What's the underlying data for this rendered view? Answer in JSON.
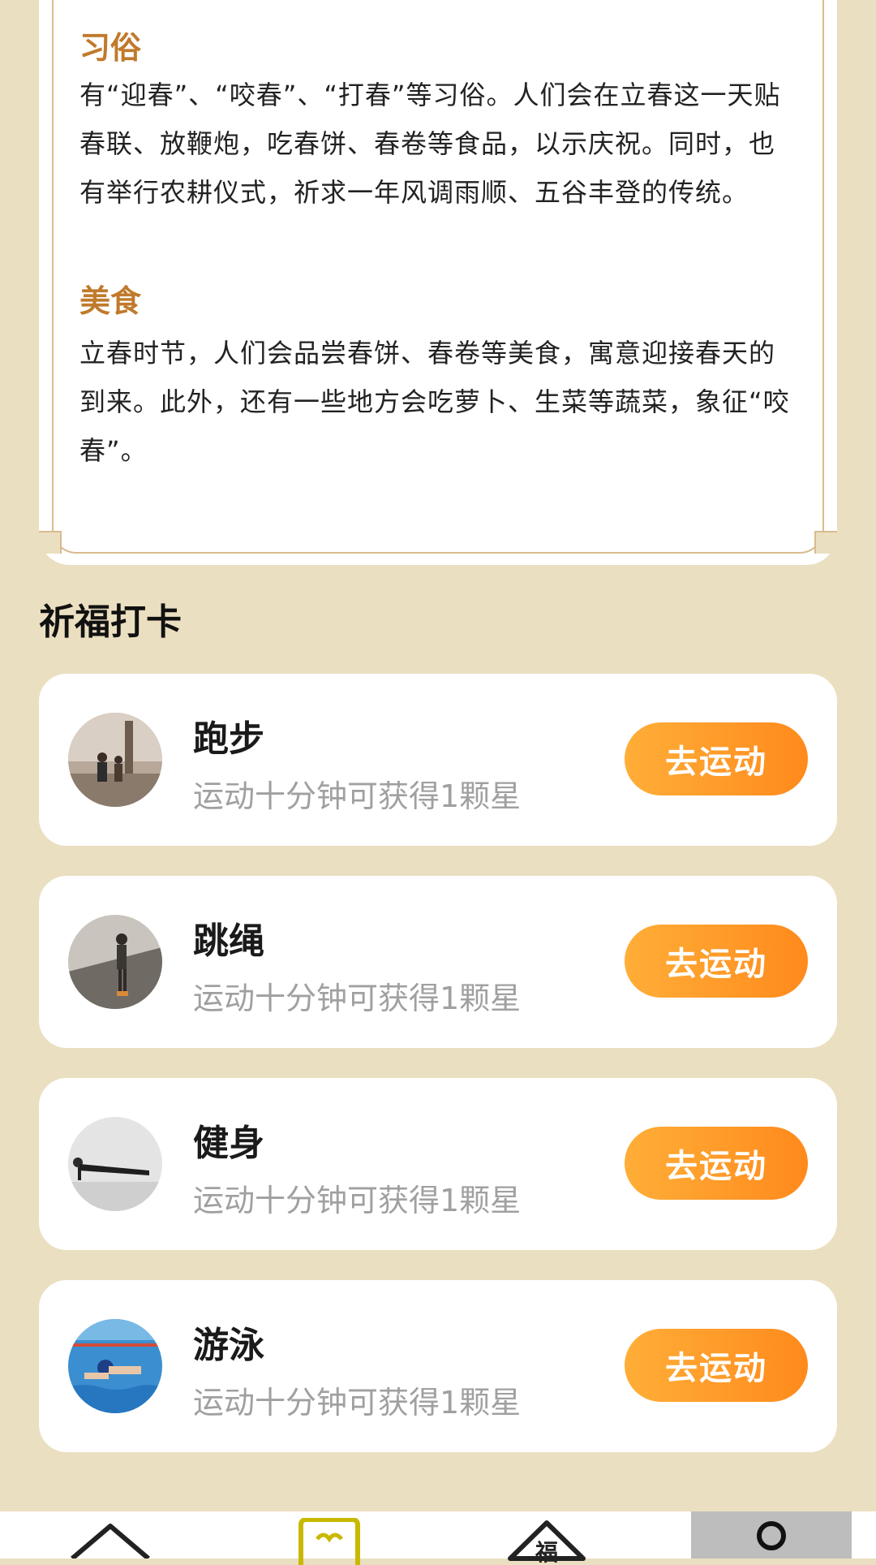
{
  "info": {
    "customs_title": "习俗",
    "customs_body": "有“迎春”、“咬春”、“打春”等习俗。人们会在立春这一天贴春联、放鞭炮，吃春饼、春卷等食品，以示庆祝。同时，也有举行农耕仪式，祈求一年风调雨顺、五谷丰登的传统。",
    "food_title": "美食",
    "food_body": "立春时节，人们会品尝春饼、春卷等美食，寓意迎接春天的到来。此外，还有一些地方会吃萝卜、生菜等蔬菜，象征“咬春”。"
  },
  "checkin": {
    "title": "祈福打卡",
    "items": [
      {
        "name": "跑步",
        "desc": "运动十分钟可获得1颗星",
        "button": "去运动"
      },
      {
        "name": "跳绳",
        "desc": "运动十分钟可获得1颗星",
        "button": "去运动"
      },
      {
        "name": "健身",
        "desc": "运动十分钟可获得1颗星",
        "button": "去运动"
      },
      {
        "name": "游泳",
        "desc": "运动十分钟可获得1颗星",
        "button": "去运动"
      }
    ]
  },
  "nav": {
    "items": [
      {
        "icon": "home-icon"
      },
      {
        "icon": "heart-card-icon"
      },
      {
        "icon": "fu-icon"
      },
      {
        "icon": "profile-icon"
      }
    ]
  },
  "colors": {
    "background": "#ebdfc1",
    "accent_title": "#c07a2c",
    "button_start": "#ffae38",
    "button_end": "#ff8a1c"
  }
}
